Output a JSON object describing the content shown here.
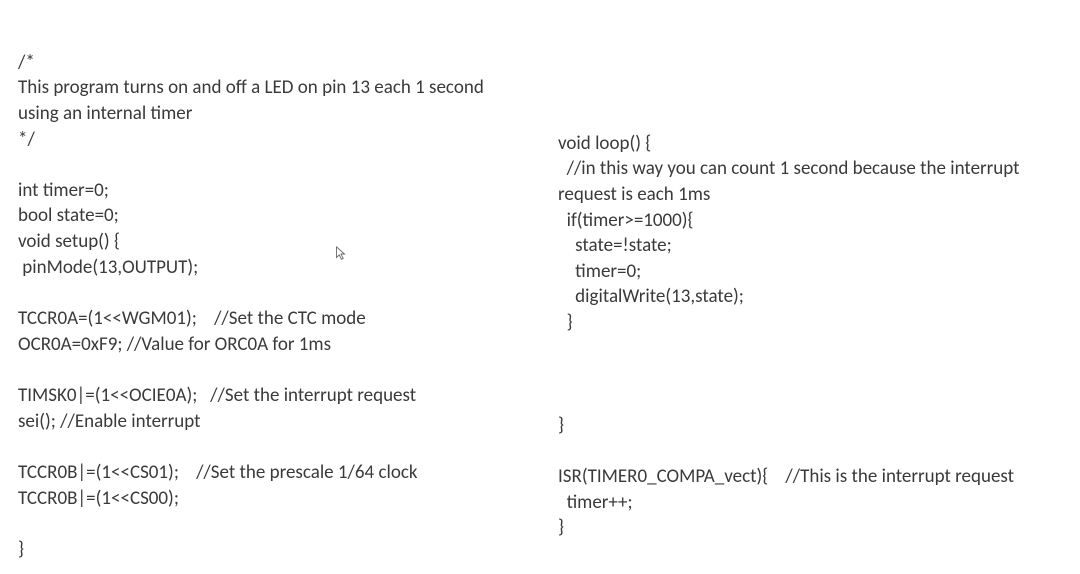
{
  "left": {
    "l01": "/*",
    "l02": "This program turns on and off a LED on pin 13 each 1 second",
    "l03": "using an internal timer",
    "l04": "*/",
    "l05": "",
    "l06": "int timer=0;",
    "l07": "bool state=0;",
    "l08": "void setup() {",
    "l09": " pinMode(13,OUTPUT);",
    "l10": "",
    "l11": "TCCR0A=(1<<WGM01);    //Set the CTC mode",
    "l12": "OCR0A=0xF9; //Value for ORC0A for 1ms",
    "l13": "",
    "l14": "TIMSK0|=(1<<OCIE0A);   //Set the interrupt request",
    "l15": "sei(); //Enable interrupt",
    "l16": "",
    "l17": "TCCR0B|=(1<<CS01);    //Set the prescale 1/64 clock",
    "l18": "TCCR0B|=(1<<CS00);",
    "l19": "",
    "l20": "}"
  },
  "right": {
    "r01": "void loop() {",
    "r02": "  //in this way you can count 1 second because the interrupt",
    "r03": "request is each 1ms",
    "r04": "  if(timer>=1000){",
    "r05": "    state=!state;",
    "r06": "    timer=0;",
    "r07": "    digitalWrite(13,state);",
    "r08": "  }",
    "r09": "",
    "r10": "",
    "r11": "",
    "r12": "}",
    "r13": "",
    "r14": "ISR(TIMER0_COMPA_vect){    //This is the interrupt request",
    "r15": "  timer++;",
    "r16": "}"
  }
}
